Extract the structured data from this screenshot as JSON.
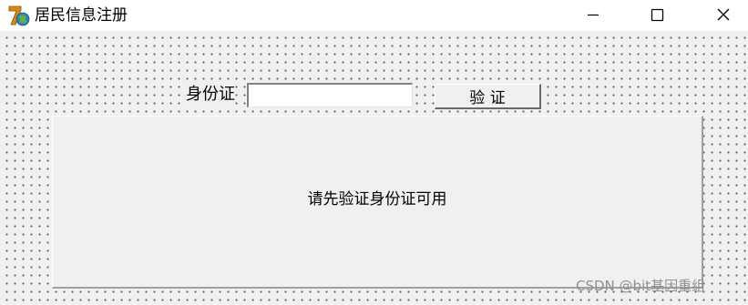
{
  "window": {
    "title": "居民信息注册",
    "icon": "app-logo-icon",
    "controls": {
      "minimize": "minimize-icon",
      "maximize": "maximize-icon",
      "close": "close-icon"
    }
  },
  "form": {
    "id_label": "身份证",
    "id_value": "",
    "verify_label": "验 证"
  },
  "status": {
    "message": "请先验证身份证可用"
  },
  "watermark": "CSDN @bit基因重组"
}
